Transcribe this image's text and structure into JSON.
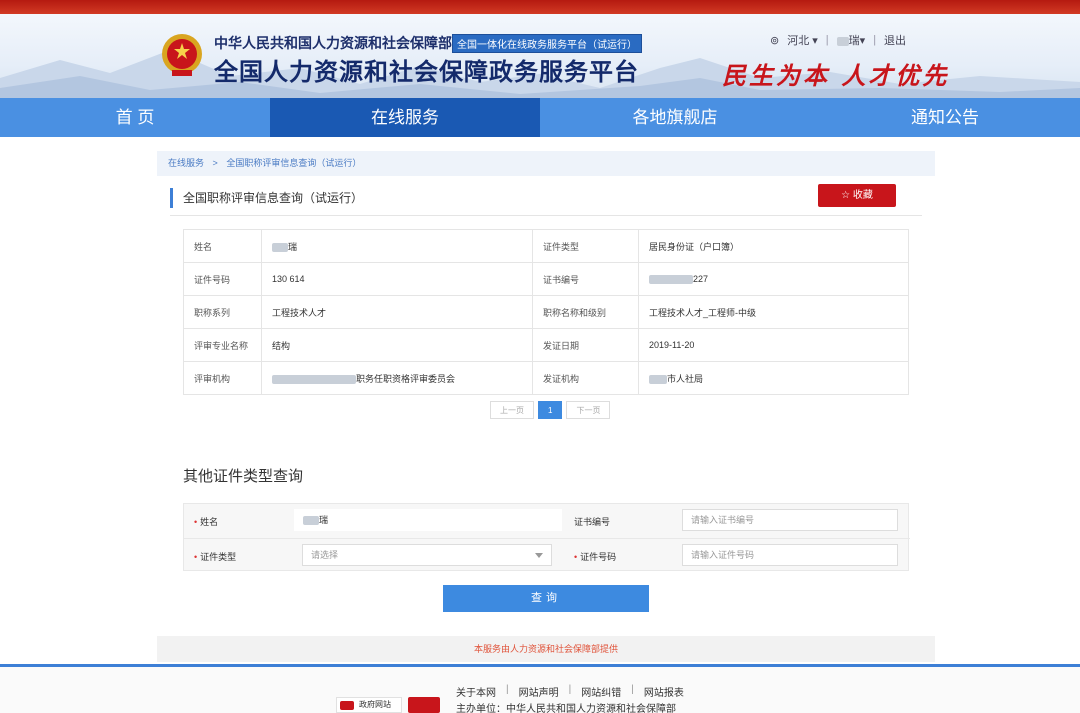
{
  "header": {
    "ministry": "中华人民共和国人力资源和社会保障部",
    "tag": "全国一体化在线政务服务平台（试运行）",
    "platform": "全国人力资源和社会保障政务服务平台",
    "slogan": "民生为本 人才优先",
    "region": "河北",
    "user_suffix": "瑞",
    "logout": "退出"
  },
  "nav": [
    "首 页",
    "在线服务",
    "各地旗舰店",
    "通知公告"
  ],
  "breadcrumb": {
    "root": "在线服务",
    "sep": ">",
    "current": "全国职称评审信息查询（试运行）"
  },
  "section_title": "全国职称评审信息查询（试运行）",
  "favorite_label": "收藏",
  "info_rows": [
    {
      "l1": "姓名",
      "v1": "瑞",
      "l2": "证件类型",
      "v2": "居民身份证（户口簿）"
    },
    {
      "l1": "证件号码",
      "v1": "130 614",
      "l2": "证书编号",
      "v2": "227"
    },
    {
      "l1": "职称系列",
      "v1": "工程技术人才",
      "l2": "职称名称和级别",
      "v2": "工程技术人才_工程师-中级"
    },
    {
      "l1": "评审专业名称",
      "v1": "结构",
      "l2": "发证日期",
      "v2": "2019-11-20"
    },
    {
      "l1": "评审机构",
      "v1": "职务任职资格评审委员会",
      "l2": "发证机构",
      "v2": "市人社局"
    }
  ],
  "pager": {
    "prev": "上一页",
    "current": "1",
    "next": "下一页"
  },
  "other_query": {
    "title": "其他证件类型查询",
    "name_label": "姓名",
    "name_value": "瑞",
    "cert_no_label": "证书编号",
    "cert_no_placeholder": "请输入证书编号",
    "id_type_label": "证件类型",
    "id_type_placeholder": "请选择",
    "id_no_label": "证件号码",
    "id_no_placeholder": "请输入证件号码",
    "query_label": "查询"
  },
  "provided_by": "本服务由人力资源和社会保障部提供",
  "footer": {
    "links": [
      "关于本网",
      "网站声明",
      "网站纠错",
      "网站报表"
    ],
    "host": "主办单位：中华人民共和国人力资源和社会保障部",
    "gov_badge": "政府网站"
  },
  "colors": {
    "brand_red": "#c8151b",
    "nav_blue": "#4a90e2",
    "nav_active": "#1a59b3",
    "button_blue": "#3d8ae0"
  }
}
